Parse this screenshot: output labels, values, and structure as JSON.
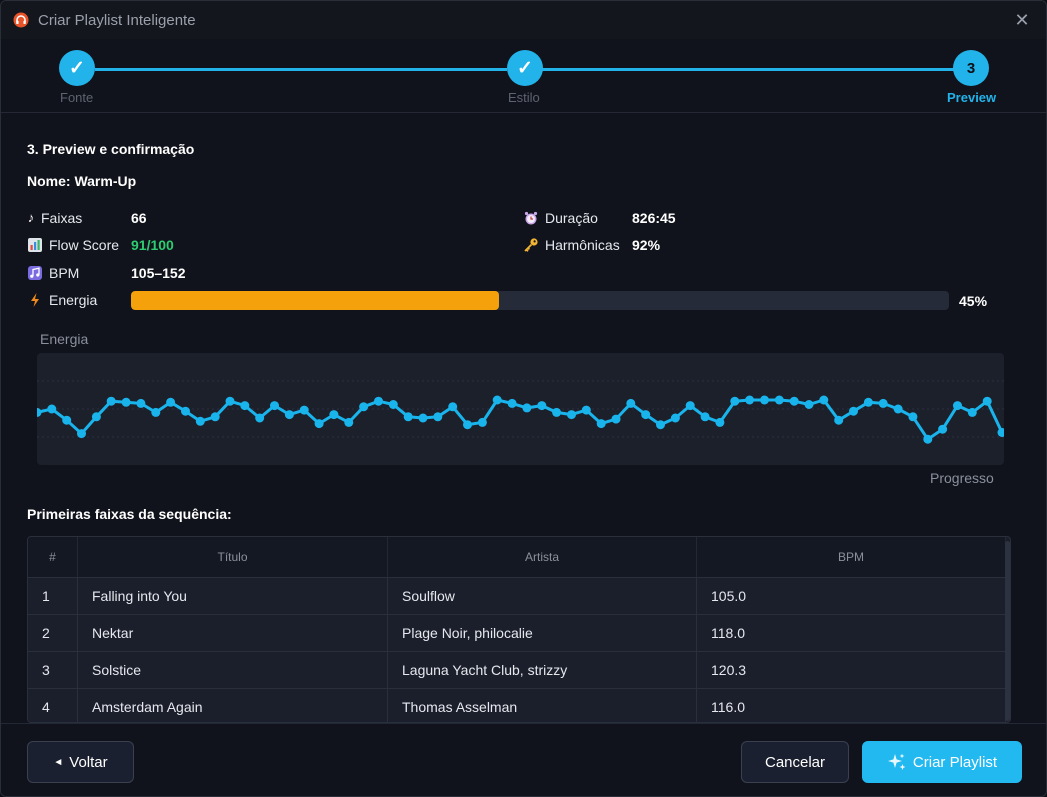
{
  "window": {
    "title": "Criar Playlist Inteligente",
    "close_glyph": "✕"
  },
  "stepper": {
    "steps": [
      {
        "label": "Fonte",
        "glyph": "✓",
        "state": "done"
      },
      {
        "label": "Estilo",
        "glyph": "✓",
        "state": "done"
      },
      {
        "label": "Preview",
        "glyph": "3",
        "state": "active"
      }
    ]
  },
  "preview": {
    "section_title": "3. Preview e confirmação",
    "name_line": "Nome: Warm-Up",
    "stats": {
      "faixas": {
        "icon": "music-note-icon",
        "label": "Faixas",
        "value": "66"
      },
      "flow": {
        "icon": "bar-chart-icon",
        "label": "Flow Score",
        "value": "91/100",
        "color": "#2ecc71"
      },
      "bpm": {
        "icon": "music-notes-icon",
        "label": "BPM",
        "value": "105–152"
      },
      "energia": {
        "icon": "lightning-icon",
        "label": "Energia",
        "value_pct": "45%",
        "fraction": 0.45
      },
      "duracao": {
        "icon": "alarm-clock-icon",
        "label": "Duração",
        "value": "826:45"
      },
      "harmonicas": {
        "icon": "key-icon",
        "label": "Harmônicas",
        "value": "92%"
      }
    }
  },
  "chart_data": {
    "type": "line",
    "ylabel": "Energia",
    "xlabel": "Progresso",
    "color": "#1ab4ec",
    "values": [
      0.47,
      0.5,
      0.4,
      0.28,
      0.43,
      0.57,
      0.56,
      0.55,
      0.47,
      0.56,
      0.48,
      0.39,
      0.43,
      0.57,
      0.53,
      0.42,
      0.53,
      0.45,
      0.49,
      0.37,
      0.45,
      0.38,
      0.52,
      0.57,
      0.54,
      0.43,
      0.42,
      0.43,
      0.52,
      0.36,
      0.38,
      0.58,
      0.55,
      0.51,
      0.53,
      0.47,
      0.45,
      0.49,
      0.37,
      0.41,
      0.55,
      0.45,
      0.36,
      0.42,
      0.53,
      0.43,
      0.38,
      0.57,
      0.58,
      0.58,
      0.58,
      0.57,
      0.54,
      0.58,
      0.4,
      0.48,
      0.56,
      0.55,
      0.5,
      0.43,
      0.23,
      0.32,
      0.53,
      0.47,
      0.57,
      0.29
    ],
    "ylim": [
      0,
      1
    ],
    "grid": true
  },
  "tracks": {
    "title": "Primeiras faixas da sequência:",
    "headers": [
      "#",
      "Título",
      "Artista",
      "BPM"
    ],
    "rows": [
      [
        "1",
        "Falling into You",
        "Soulflow",
        "105.0"
      ],
      [
        "2",
        "Nektar",
        "Plage Noir, philocalie",
        "118.0"
      ],
      [
        "3",
        "Solstice",
        "Laguna Yacht Club, strizzy",
        "120.3"
      ],
      [
        "4",
        "Amsterdam Again",
        "Thomas Asselman",
        "116.0"
      ]
    ]
  },
  "footer": {
    "back_label": "Voltar",
    "back_glyph": "◄",
    "cancel_label": "Cancelar",
    "create_label": "Criar Playlist",
    "create_icon": "sparkles-icon"
  }
}
